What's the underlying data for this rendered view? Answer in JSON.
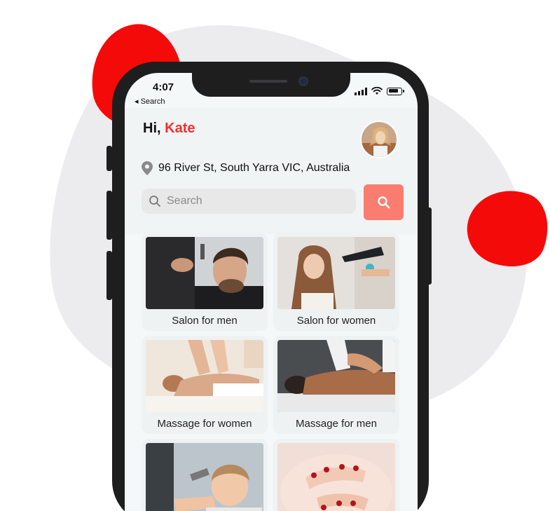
{
  "status_bar": {
    "time": "4:07",
    "back_label": "◂ Search"
  },
  "header": {
    "greeting_prefix": "Hi,",
    "user_name": "Kate",
    "address": "96 River St, South Yarra VIC, Australia"
  },
  "search": {
    "placeholder": "Search"
  },
  "categories": [
    {
      "label": "Salon for men"
    },
    {
      "label": "Salon for women"
    },
    {
      "label": "Massage for women"
    },
    {
      "label": "Massage for men"
    }
  ],
  "colors": {
    "accent": "#f0302f",
    "search_button": "#fb7c71",
    "blob": "#f50a0a"
  }
}
